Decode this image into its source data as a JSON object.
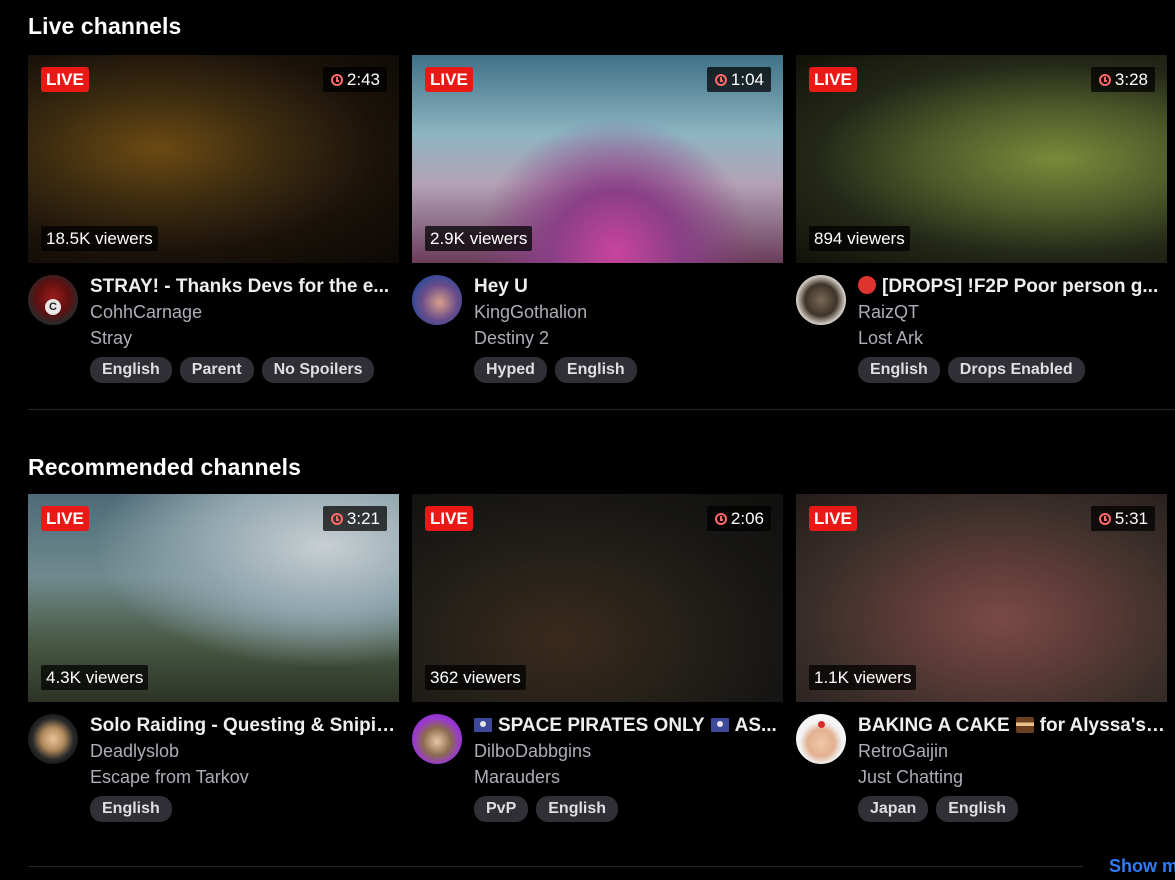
{
  "sections": [
    {
      "title": "Live channels",
      "cards": [
        {
          "live": "LIVE",
          "uptime": "2:43",
          "viewers": "18.5K viewers",
          "title": "STRAY! - Thanks Devs for the e...",
          "channel": "CohhCarnage",
          "category": "Stray",
          "tags": [
            "English",
            "Parent",
            "No Spoilers"
          ],
          "avatar": "cohhcarnage-avatar"
        },
        {
          "live": "LIVE",
          "uptime": "1:04",
          "viewers": "2.9K viewers",
          "title": "Hey U",
          "channel": "KingGothalion",
          "category": "Destiny 2",
          "tags": [
            "Hyped",
            "English"
          ],
          "avatar": "kinggothalion-avatar"
        },
        {
          "live": "LIVE",
          "uptime": "3:28",
          "viewers": "894 viewers",
          "title": "[DROPS] !F2P Poor person g...",
          "title_prefix_icon": "red-circle-emoji",
          "channel": "RaizQT",
          "category": "Lost Ark",
          "tags": [
            "English",
            "Drops Enabled"
          ],
          "avatar": "raizqt-avatar"
        }
      ]
    },
    {
      "title": "Recommended channels",
      "cards": [
        {
          "live": "LIVE",
          "uptime": "3:21",
          "viewers": "4.3K viewers",
          "title": "Solo Raiding - Questing & Snipin...",
          "channel": "Deadlyslob",
          "category": "Escape from Tarkov",
          "tags": [
            "English"
          ],
          "avatar": "deadlyslob-avatar"
        },
        {
          "live": "LIVE",
          "uptime": "2:06",
          "viewers": "362 viewers",
          "title": "SPACE PIRATES ONLY",
          "title_suffix": "AS...",
          "title_icon": "pirate-flag-emoji",
          "channel": "DilboDabbgins",
          "category": "Marauders",
          "tags": [
            "PvP",
            "English"
          ],
          "avatar": "dilbodabbgins-avatar"
        },
        {
          "live": "LIVE",
          "uptime": "5:31",
          "viewers": "1.1K viewers",
          "title": "BAKING A CAKE",
          "title_suffix": "for Alyssa's ...",
          "title_icon": "cake-emoji",
          "channel": "RetroGaijin",
          "category": "Just Chatting",
          "tags": [
            "Japan",
            "English"
          ],
          "avatar": "retrogaijin-avatar"
        }
      ]
    }
  ],
  "show_more": "Show m",
  "colors": {
    "live_badge": "#e91916",
    "link": "#2f7cf6",
    "tag_bg": "#2f2f35",
    "muted_text": "#adadb8"
  }
}
